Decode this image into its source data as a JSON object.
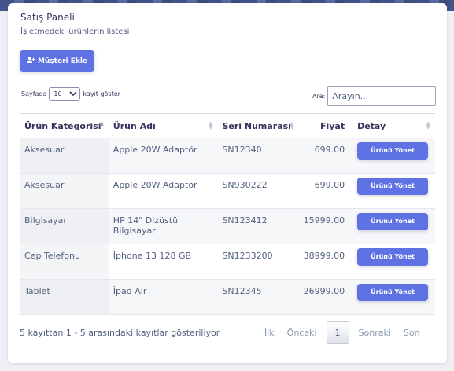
{
  "header": {
    "title": "Satış Paneli",
    "subtitle": "İşletmedeki ürünlerin listesi"
  },
  "actions": {
    "add_customer_label": "Müşteri Ekle",
    "add_customer_icon": "user-plus-icon",
    "accent": "#5e72e4"
  },
  "length": {
    "prefix": "Sayfada",
    "selected": "10",
    "suffix": "kayıt göster"
  },
  "search": {
    "label": "Ara:",
    "placeholder": "Arayın..."
  },
  "table": {
    "columns": [
      "Ürün Kategorisi",
      "Ürün Adı",
      "Seri Numarası",
      "Fiyat",
      "Detay"
    ],
    "rows": [
      {
        "category": "Aksesuar",
        "name": "Apple 20W Adaptör",
        "serial": "SN12340",
        "price": "699.00",
        "action": "Ürünü Yönet"
      },
      {
        "category": "Aksesuar",
        "name": "Apple 20W Adaptör",
        "serial": "SN930222",
        "price": "699.00",
        "action": "Ürünü Yönet"
      },
      {
        "category": "Bilgisayar",
        "name": "HP 14\" Dizüstü Bilgisayar",
        "serial": "SN123412",
        "price": "15999.00",
        "action": "Ürünü Yönet"
      },
      {
        "category": "Cep Telefonu",
        "name": "İphone 13 128 GB",
        "serial": "SN1233200",
        "price": "38999.00",
        "action": "Ürünü Yönet"
      },
      {
        "category": "Tablet",
        "name": "İpad Air",
        "serial": "SN12345",
        "price": "26999.00",
        "action": "Ürünü Yönet"
      }
    ]
  },
  "footer": {
    "info": "5 kayıttan 1 - 5 arasındaki kayıtlar gösteriliyor",
    "first": "İlk",
    "prev": "Önceki",
    "current": "1",
    "next": "Sonraki",
    "last": "Son"
  }
}
